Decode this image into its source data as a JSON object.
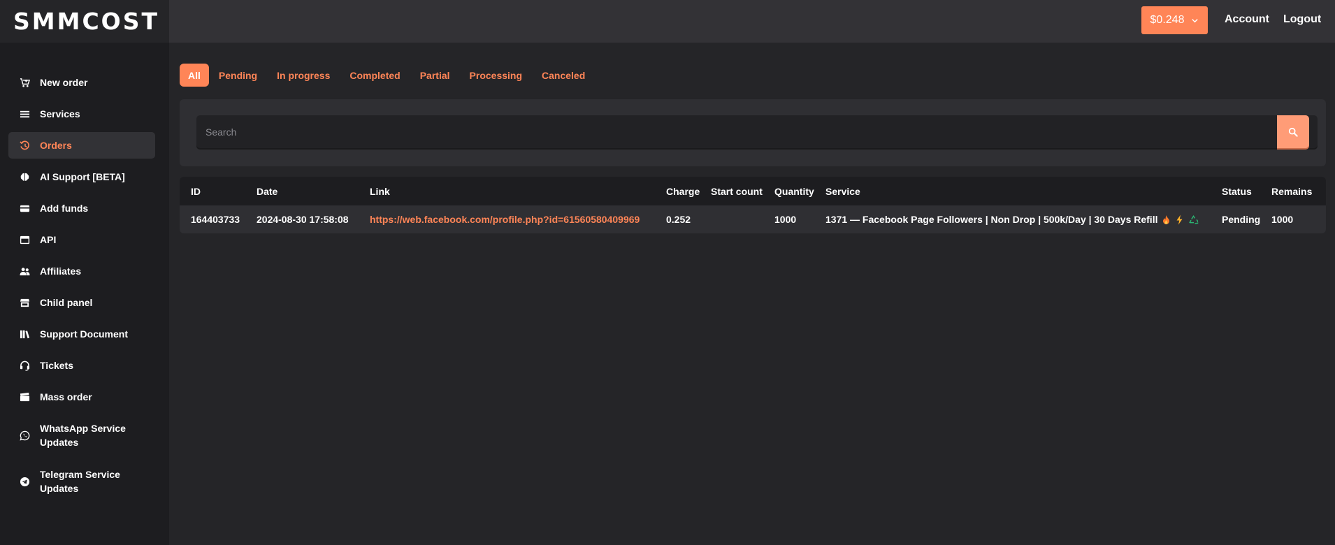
{
  "header": {
    "logo": "SMMCOST",
    "balance": "$0.248",
    "account_label": "Account",
    "logout_label": "Logout"
  },
  "sidebar": {
    "items": [
      {
        "label": "New order",
        "icon": "cart-icon",
        "active": false
      },
      {
        "label": "Services",
        "icon": "list-icon",
        "active": false
      },
      {
        "label": "Orders",
        "icon": "history-icon",
        "active": true
      },
      {
        "label": "AI Support [BETA]",
        "icon": "brain-icon",
        "active": false
      },
      {
        "label": "Add funds",
        "icon": "credit-card-icon",
        "active": false
      },
      {
        "label": "API",
        "icon": "window-icon",
        "active": false
      },
      {
        "label": "Affiliates",
        "icon": "users-icon",
        "active": false
      },
      {
        "label": "Child panel",
        "icon": "store-icon",
        "active": false
      },
      {
        "label": "Support Document",
        "icon": "books-icon",
        "active": false
      },
      {
        "label": "Tickets",
        "icon": "headset-icon",
        "active": false
      },
      {
        "label": "Mass order",
        "icon": "clapperboard-icon",
        "active": false
      },
      {
        "label": "WhatsApp Service Updates",
        "icon": "whatsapp-icon",
        "active": false
      },
      {
        "label": "Telegram Service Updates",
        "icon": "telegram-icon",
        "active": false
      }
    ]
  },
  "tabs": [
    {
      "label": "All",
      "active": true
    },
    {
      "label": "Pending",
      "active": false
    },
    {
      "label": "In progress",
      "active": false
    },
    {
      "label": "Completed",
      "active": false
    },
    {
      "label": "Partial",
      "active": false
    },
    {
      "label": "Processing",
      "active": false
    },
    {
      "label": "Canceled",
      "active": false
    }
  ],
  "search": {
    "placeholder": "Search",
    "value": ""
  },
  "table": {
    "columns": [
      "ID",
      "Date",
      "Link",
      "Charge",
      "Start count",
      "Quantity",
      "Service",
      "Status",
      "Remains"
    ],
    "rows": [
      {
        "id": "164403733",
        "date": "2024-08-30 17:58:08",
        "link": "https://web.facebook.com/profile.php?id=61560580409969",
        "charge": "0.252",
        "start_count": "",
        "quantity": "1000",
        "service": "1371 — Facebook Page Followers | Non Drop | 500k/Day | 30 Days Refill",
        "service_icons": [
          "fire-icon",
          "lightning-icon",
          "recycle-icon"
        ],
        "status": "Pending",
        "remains": "1000"
      }
    ]
  },
  "colors": {
    "accent": "#ff8557",
    "background": "#252528",
    "sidebar": "#1d1d20",
    "card": "#2f2f33"
  }
}
